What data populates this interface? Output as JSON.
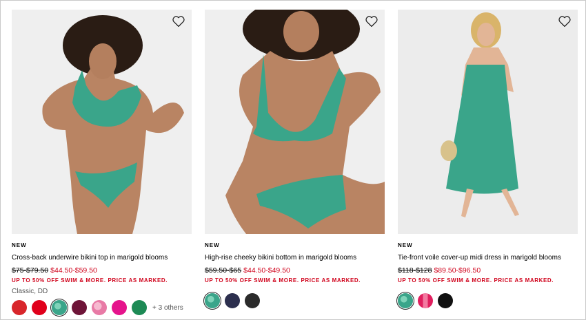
{
  "products": [
    {
      "badge": "NEW",
      "title": "Cross-back underwire bikini top in marigold blooms",
      "price_was": "$75-$79.50",
      "price_now": "$44.50-$59.50",
      "promo": "UP TO 50% OFF SWIM & MORE. PRICE AS MARKED.",
      "fit": "Classic, DD",
      "swatches": [
        "#d8262b",
        "#e0001b",
        "#3aa58a",
        "#6e1438",
        "#e87aa6",
        "#e5148c",
        "#1d8a55"
      ],
      "more": "+ 3 others"
    },
    {
      "badge": "NEW",
      "title": "High-rise cheeky bikini bottom in marigold blooms",
      "price_was": "$59.50-$65",
      "price_now": "$44.50-$49.50",
      "promo": "UP TO 50% OFF SWIM & MORE. PRICE AS MARKED.",
      "swatches": [
        "#3aa58a",
        "#2c2f4e",
        "#2b2b2b"
      ]
    },
    {
      "badge": "NEW",
      "title": "Tie-front voile cover-up midi dress in marigold blooms",
      "price_was": "$118-$128",
      "price_now": "$89.50-$96.50",
      "promo": "UP TO 50% OFF SWIM & MORE. PRICE AS MARKED.",
      "swatches": [
        "#3aa58a",
        "#e01f5e",
        "#111111"
      ]
    }
  ],
  "colors": {
    "sale_red": "#d0021b",
    "print_green": "#3aa58a"
  },
  "icons": {
    "wishlist": "heart-outline-icon"
  }
}
